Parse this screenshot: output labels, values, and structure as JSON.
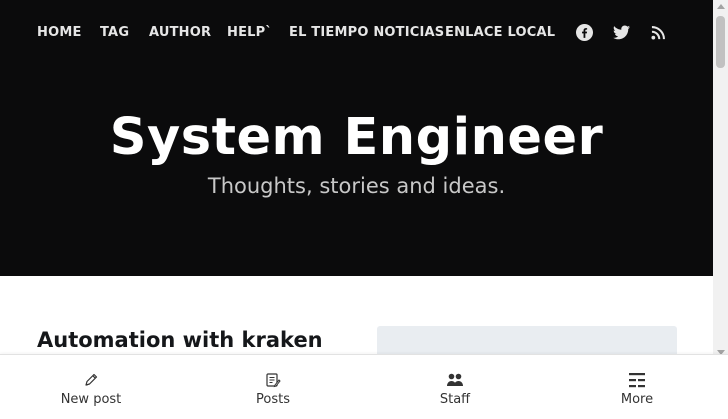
{
  "nav": {
    "items": [
      {
        "label": "HOME"
      },
      {
        "label": "TAG"
      },
      {
        "label": "AUTHOR"
      },
      {
        "label": "HELP`"
      },
      {
        "label": "EL TIEMPO NOTICIAS"
      },
      {
        "label": "ENLACE LOCAL"
      }
    ],
    "social": [
      "facebook-icon",
      "twitter-icon",
      "rss-icon"
    ]
  },
  "site": {
    "title": "System Engineer",
    "description": "Thoughts, stories and ideas."
  },
  "post": {
    "title": "Automation with kraken"
  },
  "bottom_bar": {
    "items": [
      {
        "label": "New post",
        "icon": "pencil-icon"
      },
      {
        "label": "Posts",
        "icon": "posts-icon"
      },
      {
        "label": "Staff",
        "icon": "staff-icon"
      },
      {
        "label": "More",
        "icon": "more-icon"
      }
    ]
  },
  "colors": {
    "hero_bg": "#0b0b0c",
    "nav_text": "#e6e6e6",
    "title": "#ffffff",
    "description": "#c8c8c8",
    "post_title": "#15171a",
    "image_placeholder": "#e9edf1"
  }
}
